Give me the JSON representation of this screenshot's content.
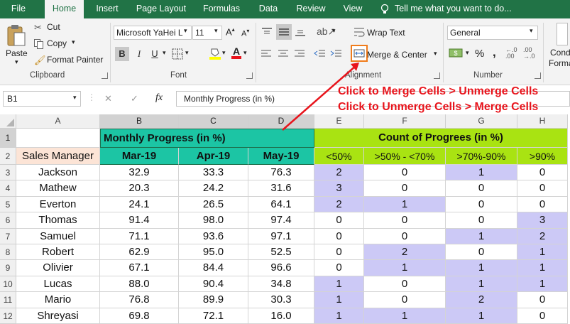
{
  "tabs": [
    "File",
    "Home",
    "Insert",
    "Page Layout",
    "Formulas",
    "Data",
    "Review",
    "View"
  ],
  "tell_me": "Tell me what you want to do...",
  "clipboard": {
    "paste": "Paste",
    "cut": "Cut",
    "copy": "Copy",
    "format_painter": "Format Painter",
    "label": "Clipboard"
  },
  "font": {
    "name": "Microsoft YaHei L",
    "size": "11",
    "bold": "B",
    "italic": "I",
    "underline": "U",
    "label": "Font"
  },
  "alignment": {
    "wrap_text": "Wrap Text",
    "merge_center": "Merge & Center",
    "label": "Alignment"
  },
  "number": {
    "format": "General",
    "currency": "$",
    "percent": "%",
    "comma": ",",
    "label": "Number"
  },
  "styles_partial": {
    "line1": "Cond",
    "line2": "Forma"
  },
  "formula_bar": {
    "name_box": "B1",
    "cancel": "✕",
    "enter": "✓",
    "fx": "fx",
    "content": "Monthly Progress (in %)"
  },
  "annotation": {
    "line1": "Click to Merge Cells > Unmerge Cells",
    "line2": "Click to Unmerge Cells > Merge Cells",
    "color": "#e8141c"
  },
  "columns": [
    "A",
    "B",
    "C",
    "D",
    "E",
    "F",
    "G",
    "H"
  ],
  "merged": {
    "monthly": "Monthly Progress (in %)",
    "count": "Count of Progrees (in %)"
  },
  "headers": [
    "Sales Manager",
    "Mar-19",
    "Apr-19",
    "May-19",
    "<50%",
    ">50% - <70%",
    ">70%-90%",
    ">90%"
  ],
  "rows": [
    {
      "num": "3",
      "name": "Jackson",
      "vals": [
        "32.9",
        "33.3",
        "76.3",
        "2",
        "0",
        "1",
        "0"
      ]
    },
    {
      "num": "4",
      "name": "Mathew",
      "vals": [
        "20.3",
        "24.2",
        "31.6",
        "3",
        "0",
        "0",
        "0"
      ]
    },
    {
      "num": "5",
      "name": "Everton",
      "vals": [
        "24.1",
        "26.5",
        "64.1",
        "2",
        "1",
        "0",
        "0"
      ]
    },
    {
      "num": "6",
      "name": "Thomas",
      "vals": [
        "91.4",
        "98.0",
        "97.4",
        "0",
        "0",
        "0",
        "3"
      ]
    },
    {
      "num": "7",
      "name": "Samuel",
      "vals": [
        "71.1",
        "93.6",
        "97.1",
        "0",
        "0",
        "1",
        "2"
      ]
    },
    {
      "num": "8",
      "name": "Robert",
      "vals": [
        "62.9",
        "95.0",
        "52.5",
        "0",
        "2",
        "0",
        "1"
      ]
    },
    {
      "num": "9",
      "name": "Olivier",
      "vals": [
        "67.1",
        "84.4",
        "96.6",
        "0",
        "1",
        "1",
        "1"
      ]
    },
    {
      "num": "10",
      "name": "Lucas",
      "vals": [
        "88.0",
        "90.4",
        "34.8",
        "1",
        "0",
        "1",
        "1"
      ]
    },
    {
      "num": "11",
      "name": "Mario",
      "vals": [
        "76.8",
        "89.9",
        "30.3",
        "1",
        "0",
        "2",
        "0"
      ]
    },
    {
      "num": "12",
      "name": "Shreyasi",
      "vals": [
        "69.8",
        "72.1",
        "16.0",
        "1",
        "1",
        "1",
        "0"
      ]
    }
  ],
  "row_nums_top": [
    "1",
    "2"
  ],
  "colors": {
    "excel_green": "#217346",
    "header_teal": "#1cc5a4",
    "header_lime": "#a9e312",
    "purple_fill": "#ccc9f6",
    "sales_manager_fill": "#fce4d6",
    "highlight_orange": "#f07c1c"
  }
}
